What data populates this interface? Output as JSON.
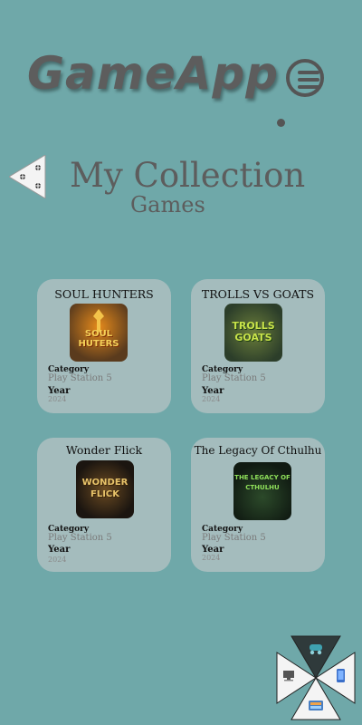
{
  "header": {
    "logo_text": "GameApp",
    "logo_icon": "gamepad-icon",
    "menu_icon": "hamburger-menu-icon"
  },
  "page": {
    "back_icon": "back-arrow-icon",
    "title": "My Collection",
    "subtitle": "Games"
  },
  "labels": {
    "category": "Category",
    "year": "Year"
  },
  "games": [
    {
      "title": "SOUL HUNTERS",
      "category": "Play Station 5",
      "year": "2024",
      "thumb_text": "SOUL HUTERS",
      "thumb_colors": [
        "#5a3b1d",
        "#e58a1c"
      ]
    },
    {
      "title": "TROLLS VS GOATS",
      "category": "Play Station 5",
      "year": "2024",
      "thumb_text": "TROLLS GOATS",
      "thumb_colors": [
        "#2c3e2a",
        "#b6d33a"
      ]
    },
    {
      "title": "Wonder Flick",
      "category": "Play Station 5",
      "year": "2024",
      "thumb_text": "WONDER FLICK",
      "thumb_colors": [
        "#1b1510",
        "#c9a048"
      ]
    },
    {
      "title": "The Legacy Of Cthulhu",
      "category": "Play Station 5",
      "year": "2024",
      "thumb_text": "THE LEGACY OF CTHULHU",
      "thumb_colors": [
        "#101a12",
        "#7fcf4a"
      ]
    }
  ],
  "fab": {
    "icons": [
      "controller-icon",
      "computer-icon",
      "phone-icon",
      "tablet-icon"
    ]
  }
}
